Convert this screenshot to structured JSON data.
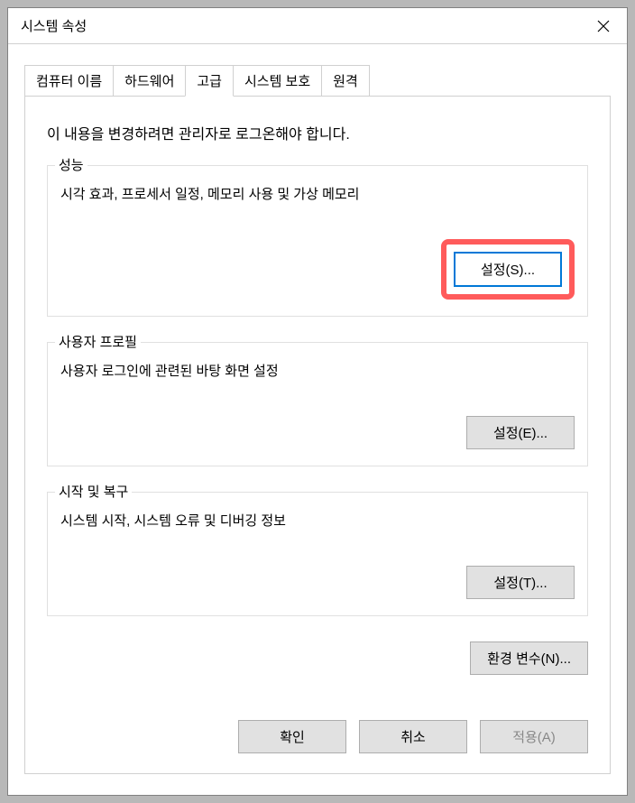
{
  "window": {
    "title": "시스템 속성"
  },
  "tabs": {
    "computer_name": "컴퓨터 이름",
    "hardware": "하드웨어",
    "advanced": "고급",
    "system_protection": "시스템 보호",
    "remote": "원격"
  },
  "intro": "이 내용을 변경하려면 관리자로 로그온해야 합니다.",
  "performance": {
    "legend": "성능",
    "desc": "시각 효과, 프로세서 일정, 메모리 사용 및 가상 메모리",
    "button": "설정(S)..."
  },
  "user_profile": {
    "legend": "사용자 프로필",
    "desc": "사용자 로그인에 관련된 바탕 화면 설정",
    "button": "설정(E)..."
  },
  "startup": {
    "legend": "시작 및 복구",
    "desc": "시스템 시작, 시스템 오류 및 디버깅 정보",
    "button": "설정(T)..."
  },
  "env_vars_button": "환경 변수(N)...",
  "buttons": {
    "ok": "확인",
    "cancel": "취소",
    "apply": "적용(A)"
  }
}
